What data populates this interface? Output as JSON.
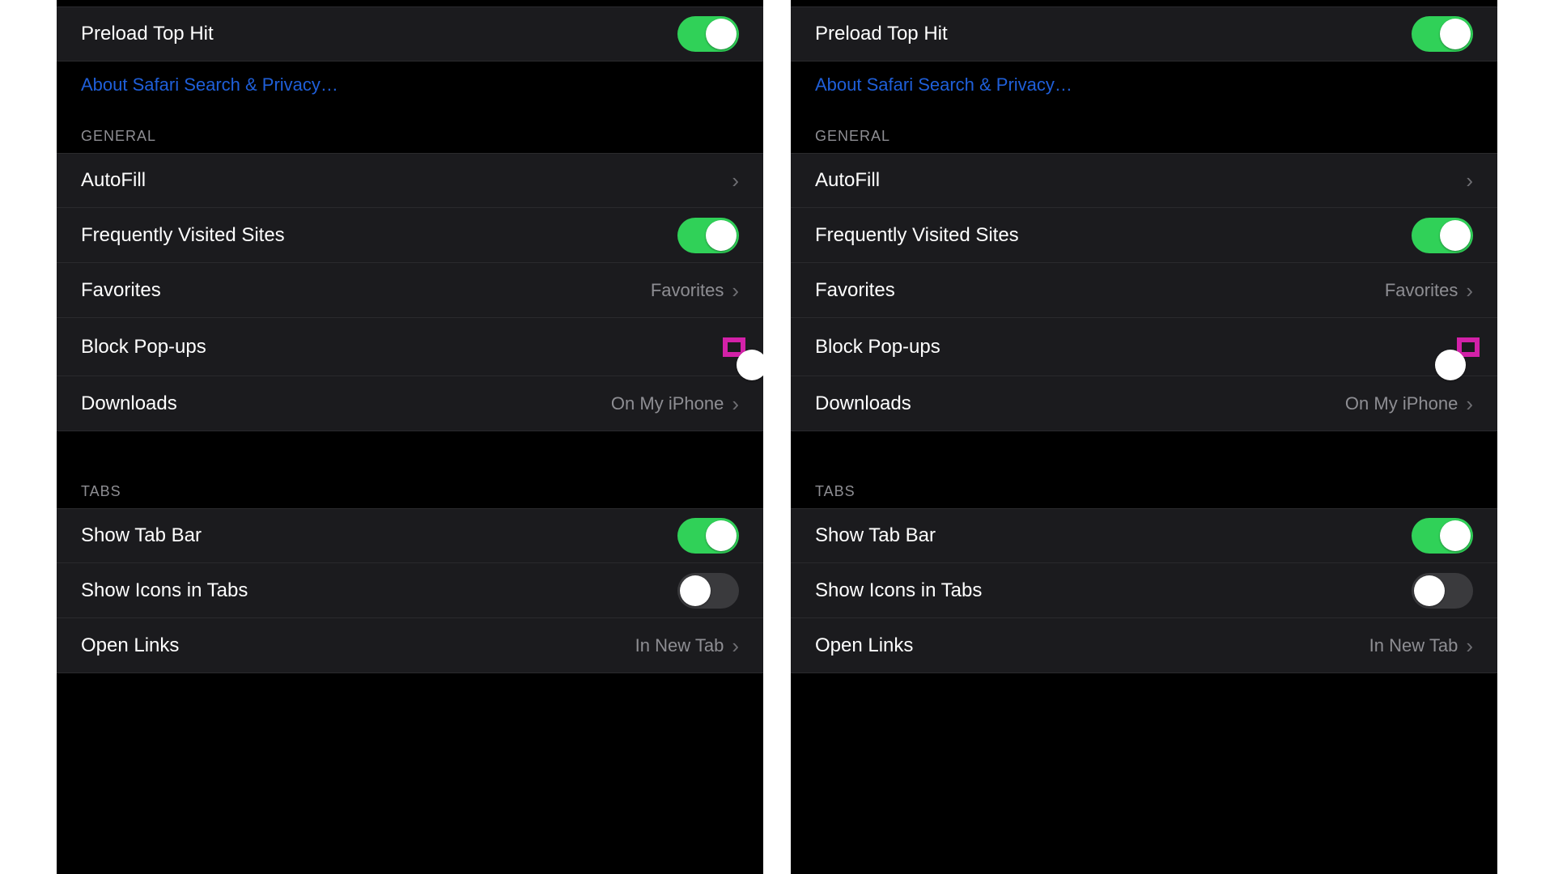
{
  "colors": {
    "accent_green": "#30d158",
    "link_blue": "#1f5fd9",
    "highlight": "#d321a8"
  },
  "panels": [
    {
      "id": "left",
      "preload": {
        "label": "Preload Top Hit",
        "on": true
      },
      "about_link": "About Safari Search & Privacy…",
      "general_header": "GENERAL",
      "general": {
        "autofill": {
          "label": "AutoFill"
        },
        "freq_visited": {
          "label": "Frequently Visited Sites",
          "on": true
        },
        "favorites": {
          "label": "Favorites",
          "value": "Favorites"
        },
        "block_popups": {
          "label": "Block Pop-ups",
          "on": false,
          "highlighted": true
        },
        "downloads": {
          "label": "Downloads",
          "value": "On My iPhone"
        }
      },
      "tabs_header": "TABS",
      "tabs": {
        "show_tab_bar": {
          "label": "Show Tab Bar",
          "on": true
        },
        "show_icons": {
          "label": "Show Icons in Tabs",
          "on": false
        },
        "open_links": {
          "label": "Open Links",
          "value": "In New Tab"
        }
      }
    },
    {
      "id": "right",
      "preload": {
        "label": "Preload Top Hit",
        "on": true
      },
      "about_link": "About Safari Search & Privacy…",
      "general_header": "GENERAL",
      "general": {
        "autofill": {
          "label": "AutoFill"
        },
        "freq_visited": {
          "label": "Frequently Visited Sites",
          "on": true
        },
        "favorites": {
          "label": "Favorites",
          "value": "Favorites"
        },
        "block_popups": {
          "label": "Block Pop-ups",
          "on": true,
          "highlighted": true
        },
        "downloads": {
          "label": "Downloads",
          "value": "On My iPhone"
        }
      },
      "tabs_header": "TABS",
      "tabs": {
        "show_tab_bar": {
          "label": "Show Tab Bar",
          "on": true
        },
        "show_icons": {
          "label": "Show Icons in Tabs",
          "on": false
        },
        "open_links": {
          "label": "Open Links",
          "value": "In New Tab"
        }
      }
    }
  ]
}
